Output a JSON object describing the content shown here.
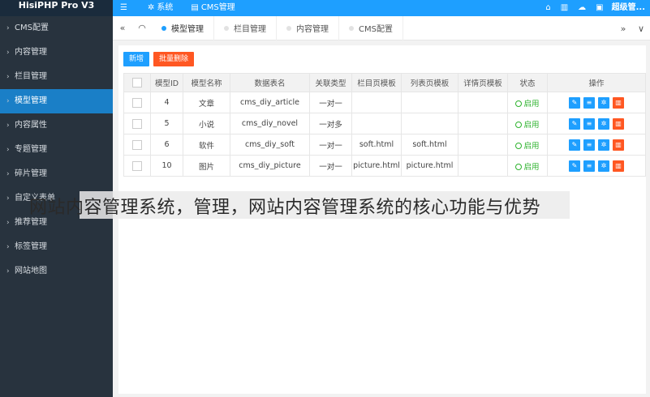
{
  "app": {
    "title": "HisiPHP Pro V3"
  },
  "top_nav": [
    {
      "icon": "menu-toggle-icon",
      "glyph": "☰",
      "label": ""
    },
    {
      "icon": "gear-icon",
      "glyph": "✲",
      "label": "系统"
    },
    {
      "icon": "list-icon",
      "glyph": "▤",
      "label": "CMS管理"
    }
  ],
  "top_right": {
    "home_glyph": "⌂",
    "trash_glyph": "▥",
    "cloud_glyph": "☁",
    "lock_glyph": "▣",
    "user_label": "超级管..."
  },
  "sidebar": {
    "items": [
      {
        "label": "CMS配置",
        "active": false
      },
      {
        "label": "内容管理",
        "active": false
      },
      {
        "label": "栏目管理",
        "active": false
      },
      {
        "label": "模型管理",
        "active": true
      },
      {
        "label": "内容属性",
        "active": false
      },
      {
        "label": "专题管理",
        "active": false
      },
      {
        "label": "碎片管理",
        "active": false
      },
      {
        "label": "自定义表单",
        "active": false
      },
      {
        "label": "推荐管理",
        "active": false
      },
      {
        "label": "标签管理",
        "active": false
      },
      {
        "label": "网站地图",
        "active": false
      }
    ]
  },
  "tabs": {
    "left_btn": "«",
    "home_glyph": "◠",
    "items": [
      {
        "label": "模型管理",
        "active": true
      },
      {
        "label": "栏目管理",
        "active": false
      },
      {
        "label": "内容管理",
        "active": false
      },
      {
        "label": "CMS配置",
        "active": false
      }
    ],
    "right_btn": "»",
    "dropdown": "∨"
  },
  "toolbar": {
    "add_label": "新增",
    "batch_delete_label": "批量删除"
  },
  "table": {
    "headers": [
      "",
      "模型ID",
      "模型名称",
      "数据表名",
      "关联类型",
      "栏目页模板",
      "列表页模板",
      "详情页模板",
      "状态",
      "操作"
    ],
    "rows": [
      {
        "id": "4",
        "name": "文章",
        "table": "cms_diy_article",
        "relation": "一对一",
        "cat_tpl": "",
        "list_tpl": "",
        "detail_tpl": "",
        "status": "启用"
      },
      {
        "id": "5",
        "name": "小说",
        "table": "cms_diy_novel",
        "relation": "一对多",
        "cat_tpl": "",
        "list_tpl": "",
        "detail_tpl": "",
        "status": "启用"
      },
      {
        "id": "6",
        "name": "软件",
        "table": "cms_diy_soft",
        "relation": "一对一",
        "cat_tpl": "soft.html",
        "list_tpl": "soft.html",
        "detail_tpl": "",
        "status": "启用"
      },
      {
        "id": "10",
        "name": "图片",
        "table": "cms_diy_picture",
        "relation": "一对一",
        "cat_tpl": "picture.html",
        "list_tpl": "picture.html",
        "detail_tpl": "",
        "status": "启用"
      }
    ]
  },
  "caption": "网站内容管理系统，管理，网站内容管理系统的核心功能与优势",
  "colors": {
    "topbar": "#1e9fff",
    "sidebar": "#28333e",
    "active": "#1a7fc7",
    "danger": "#ff5722",
    "success": "#2db32d"
  }
}
